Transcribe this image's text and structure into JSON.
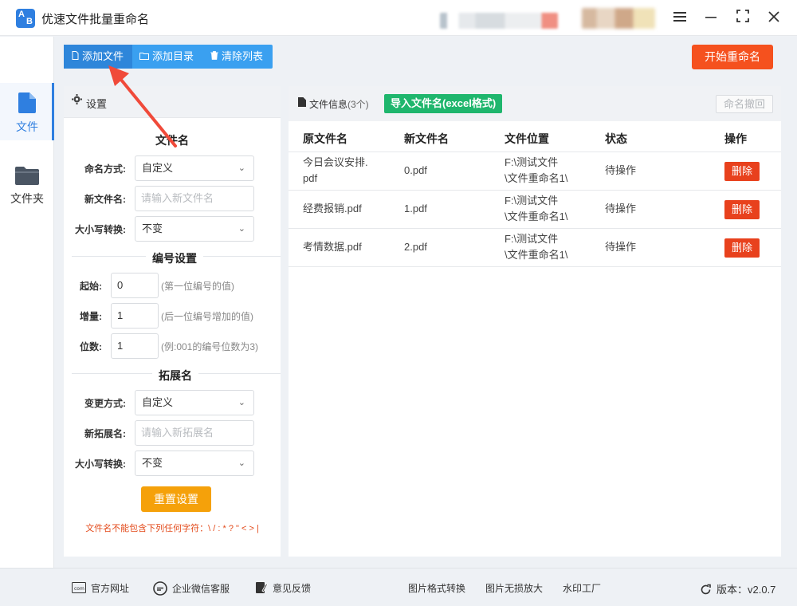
{
  "app": {
    "logo_text_a": "A",
    "logo_text_b": "B",
    "title": "优速文件批量重命名"
  },
  "window_controls": {
    "menu_icon": "menu-icon",
    "minimize_icon": "minimize-icon",
    "maximize_icon": "maximize-icon",
    "close_icon": "close-icon"
  },
  "nav": {
    "items": [
      {
        "label": "文件",
        "icon": "file-icon",
        "active": true
      },
      {
        "label": "文件夹",
        "icon": "folder-icon",
        "active": false
      }
    ]
  },
  "toolbar": {
    "add_file": "添加文件",
    "add_dir": "添加目录",
    "clear_list": "清除列表"
  },
  "start_button": "开始重命名",
  "settings": {
    "header": "设置",
    "filename_section": "文件名",
    "naming_mode_label": "命名方式:",
    "naming_mode_value": "自定义",
    "new_name_label": "新文件名:",
    "new_name_placeholder": "请输入新文件名",
    "case_label": "大小写转换:",
    "case_value": "不变",
    "number_section": "编号设置",
    "start_label": "起始:",
    "start_value": "0",
    "start_hint": "(第一位编号的值)",
    "step_label": "增量:",
    "step_value": "1",
    "step_hint": "(后一位编号增加的值)",
    "digits_label": "位数:",
    "digits_value": "1",
    "digits_hint": "(例:001的编号位数为3)",
    "ext_section": "拓展名",
    "ext_mode_label": "变更方式:",
    "ext_mode_value": "自定义",
    "new_ext_label": "新拓展名:",
    "new_ext_placeholder": "请输入新拓展名",
    "ext_case_label": "大小写转换:",
    "ext_case_value": "不变",
    "reset_button": "重置设置",
    "warning": "文件名不能包含下列任何字符：\\ / : * ? \" < > |"
  },
  "files": {
    "header_title": "文件信息",
    "header_count": "(3个)",
    "import_button": "导入文件名(excel格式)",
    "undo_button": "命名撤回",
    "columns": [
      "原文件名",
      "新文件名",
      "文件位置",
      "状态",
      "操作"
    ],
    "rows": [
      {
        "original_line1": "今日会议安排.",
        "original_line2": "pdf",
        "new_name": "0.pdf",
        "location_line1": "F:\\测试文件",
        "location_line2": "\\文件重命名1\\",
        "status": "待操作",
        "action": "删除"
      },
      {
        "original_line1": "经费报销.pdf",
        "original_line2": "",
        "new_name": "1.pdf",
        "location_line1": "F:\\测试文件",
        "location_line2": "\\文件重命名1\\",
        "status": "待操作",
        "action": "删除"
      },
      {
        "original_line1": "考情数据.pdf",
        "original_line2": "",
        "new_name": "2.pdf",
        "location_line1": "F:\\测试文件",
        "location_line2": "\\文件重命名1\\",
        "status": "待操作",
        "action": "删除"
      }
    ]
  },
  "footer": {
    "website": "官方网址",
    "wechat": "企业微信客服",
    "feedback": "意见反馈",
    "image_convert": "图片格式转换",
    "image_enlarge": "图片无损放大",
    "watermark": "水印工厂",
    "version": "版本：v2.0.7"
  },
  "colors": {
    "accent_blue": "#2f7fe0",
    "toolbar_blue": "#3aa0f0",
    "start_red": "#f5511e",
    "import_green": "#1fb66d",
    "reset_orange": "#f5a10a",
    "delete_red": "#e8411d"
  }
}
